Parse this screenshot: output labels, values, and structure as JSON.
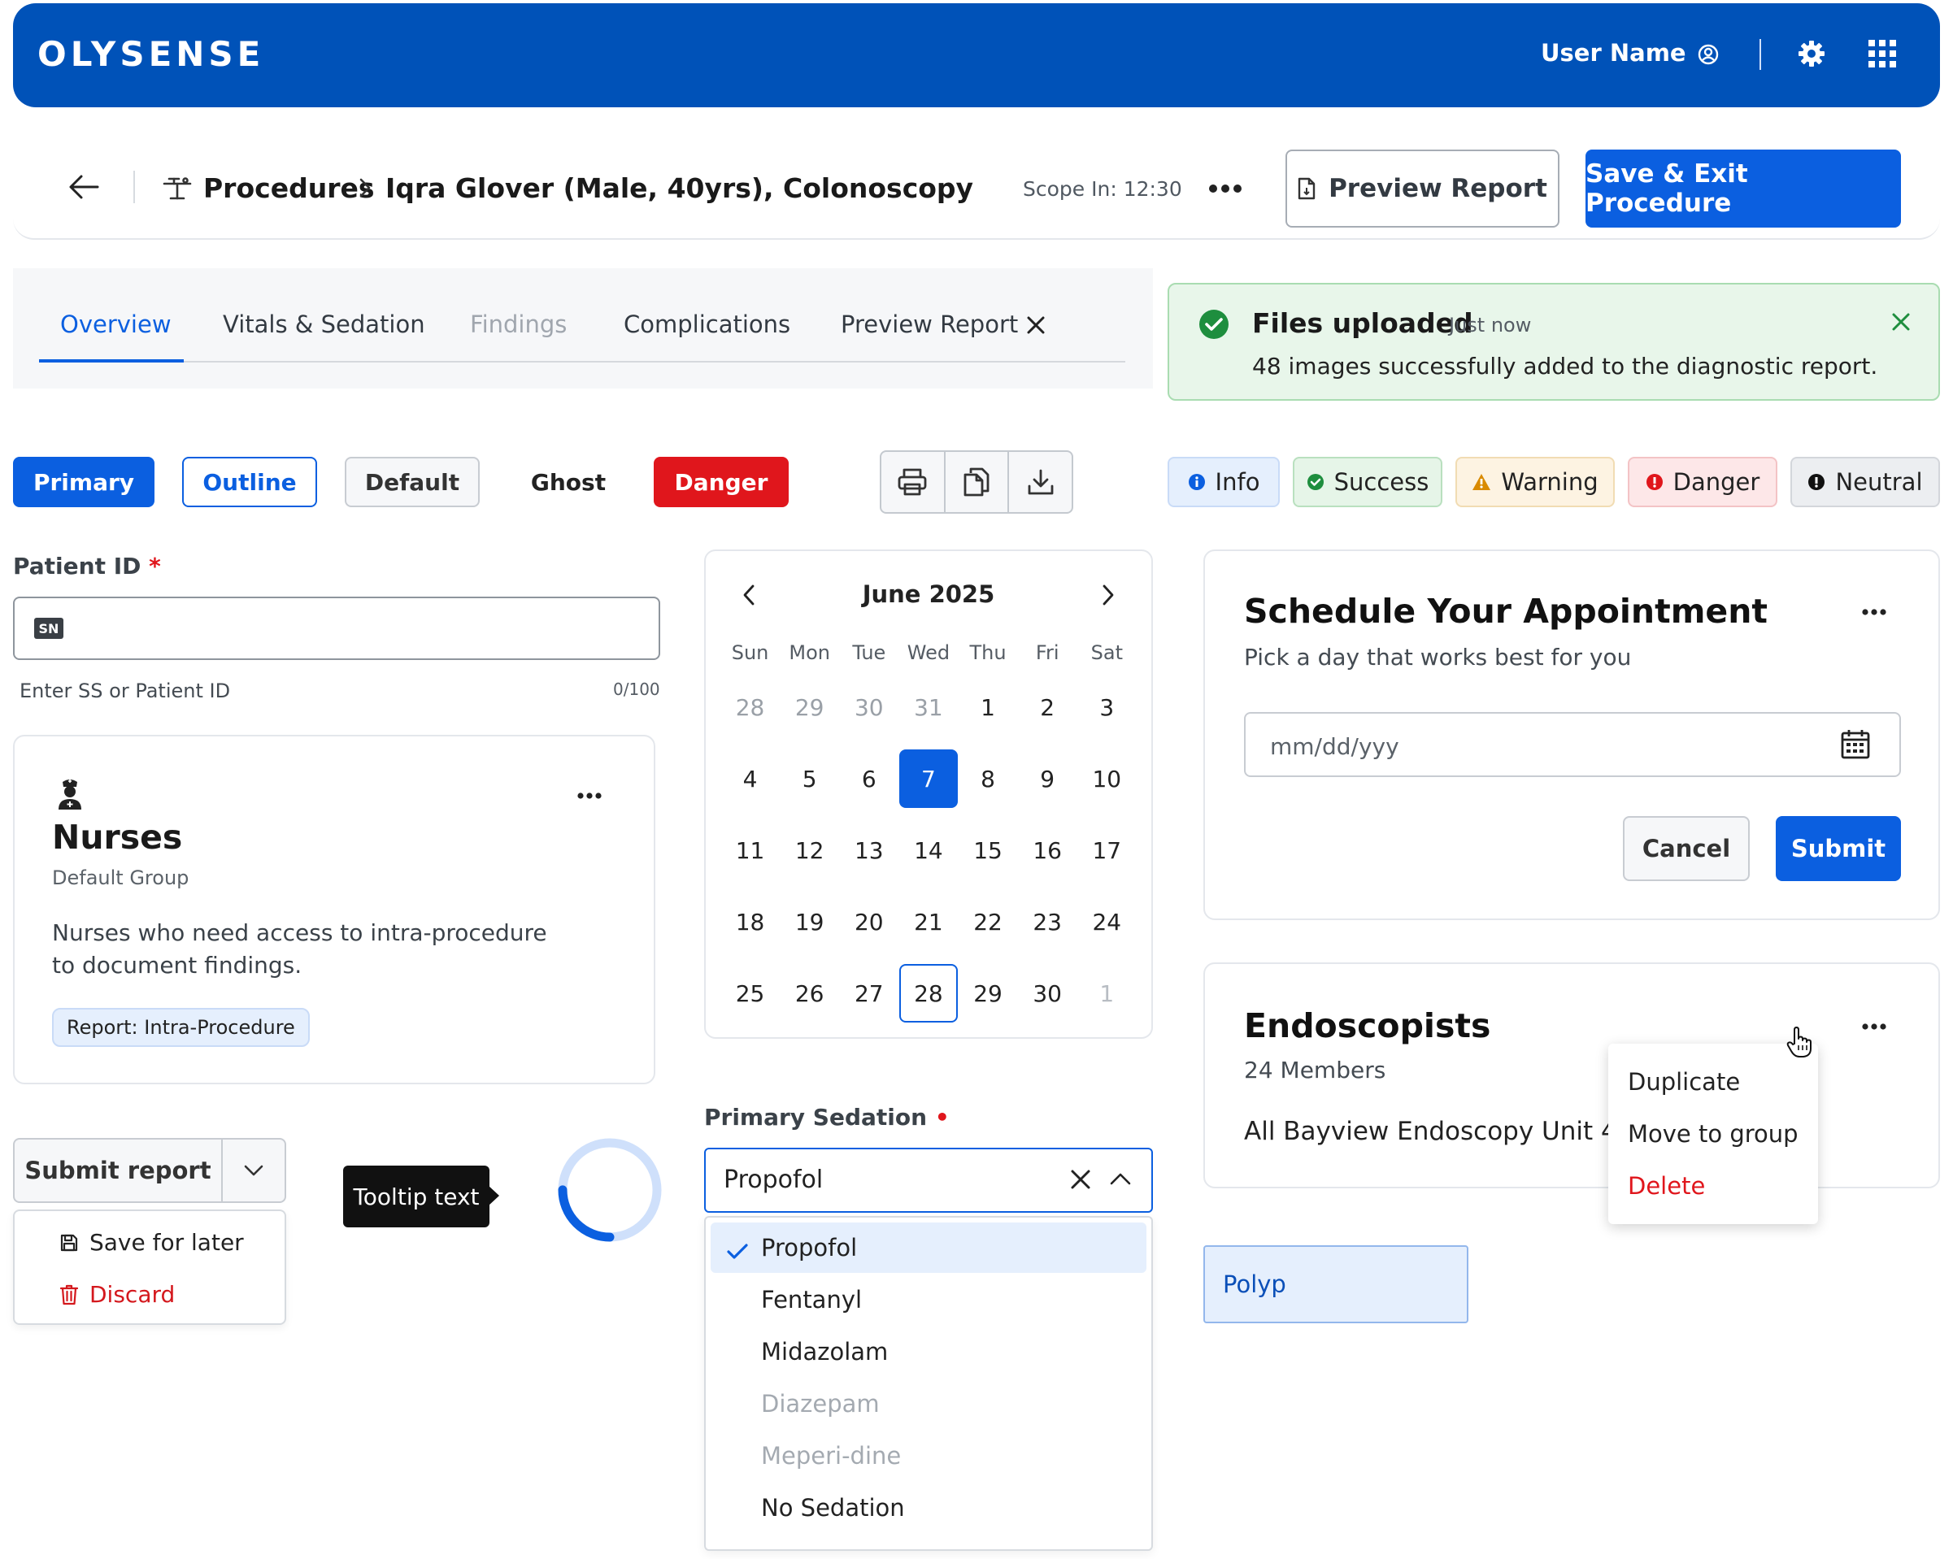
{
  "header": {
    "logo": "OLYSENSE",
    "user_name": "User Name"
  },
  "breadcrumb": {
    "section": "Procedures",
    "patient": "Iqra Glover (Male, 40yrs), Colonoscopy",
    "scope_in": "Scope In: 12:30",
    "preview_label": "Preview Report",
    "save_exit_label": "Save & Exit Procedure"
  },
  "tabs": [
    {
      "label": "Overview",
      "state": "active"
    },
    {
      "label": "Vitals & Sedation",
      "state": "normal"
    },
    {
      "label": "Findings",
      "state": "disabled"
    },
    {
      "label": "Complications",
      "state": "normal"
    },
    {
      "label": "Preview Report",
      "state": "closable"
    }
  ],
  "toast": {
    "title": "Files uploaded",
    "time": "Just now",
    "message": "48 images successfully added to the diagnostic report."
  },
  "buttons": {
    "primary": "Primary",
    "outline": "Outline",
    "default": "Default",
    "ghost": "Ghost",
    "danger": "Danger"
  },
  "badges": {
    "info": "Info",
    "success": "Success",
    "warning": "Warning",
    "danger": "Danger",
    "neutral": "Neutral"
  },
  "patient_id": {
    "label": "Patient ID",
    "required_mark": "*",
    "prefix_badge": "SN",
    "value": "",
    "helper": "Enter SS or Patient ID",
    "counter": "0/100"
  },
  "nurses_card": {
    "title": "Nurses",
    "subtitle": "Default Group",
    "description": "Nurses who need access to intra-procedure to document findings.",
    "tag": "Report: Intra-Procedure"
  },
  "split_button": {
    "label": "Submit report",
    "menu": {
      "save": "Save for later",
      "discard": "Discard"
    }
  },
  "tooltip": {
    "text": "Tooltip text"
  },
  "spinner": {
    "progress": 0.25
  },
  "calendar": {
    "title": "June 2025",
    "weekdays": [
      "Sun",
      "Mon",
      "Tue",
      "Wed",
      "Thu",
      "Fri",
      "Sat"
    ],
    "weeks": [
      [
        {
          "d": "28",
          "s": "muted"
        },
        {
          "d": "29",
          "s": "muted"
        },
        {
          "d": "30",
          "s": "muted"
        },
        {
          "d": "31",
          "s": "muted"
        },
        {
          "d": "1",
          "s": ""
        },
        {
          "d": "2",
          "s": ""
        },
        {
          "d": "3",
          "s": ""
        }
      ],
      [
        {
          "d": "4",
          "s": ""
        },
        {
          "d": "5",
          "s": ""
        },
        {
          "d": "6",
          "s": ""
        },
        {
          "d": "7",
          "s": "sel"
        },
        {
          "d": "8",
          "s": ""
        },
        {
          "d": "9",
          "s": ""
        },
        {
          "d": "10",
          "s": ""
        }
      ],
      [
        {
          "d": "11",
          "s": ""
        },
        {
          "d": "12",
          "s": ""
        },
        {
          "d": "13",
          "s": ""
        },
        {
          "d": "14",
          "s": ""
        },
        {
          "d": "15",
          "s": ""
        },
        {
          "d": "16",
          "s": ""
        },
        {
          "d": "17",
          "s": ""
        }
      ],
      [
        {
          "d": "18",
          "s": ""
        },
        {
          "d": "19",
          "s": ""
        },
        {
          "d": "20",
          "s": ""
        },
        {
          "d": "21",
          "s": ""
        },
        {
          "d": "22",
          "s": ""
        },
        {
          "d": "23",
          "s": ""
        },
        {
          "d": "24",
          "s": ""
        }
      ],
      [
        {
          "d": "25",
          "s": ""
        },
        {
          "d": "26",
          "s": ""
        },
        {
          "d": "27",
          "s": ""
        },
        {
          "d": "28",
          "s": "today"
        },
        {
          "d": "29",
          "s": ""
        },
        {
          "d": "30",
          "s": ""
        },
        {
          "d": "1",
          "s": "light"
        }
      ]
    ]
  },
  "sedation": {
    "label": "Primary Sedation",
    "required_mark": "•",
    "value": "Propofol",
    "options": [
      {
        "label": "Propofol",
        "state": "selected"
      },
      {
        "label": "Fentanyl",
        "state": "normal"
      },
      {
        "label": "Midazolam",
        "state": "normal"
      },
      {
        "label": "Diazepam",
        "state": "disabled"
      },
      {
        "label": "Meperi-dine",
        "state": "disabled"
      },
      {
        "label": "No Sedation",
        "state": "normal"
      }
    ]
  },
  "schedule_card": {
    "title": "Schedule Your Appointment",
    "subtitle": "Pick a day that works best for you",
    "date_placeholder": "mm/dd/yyy",
    "cancel": "Cancel",
    "submit": "Submit"
  },
  "endoscopists_card": {
    "title": "Endoscopists",
    "members": "24 Members",
    "description": "All Bayview Endoscopy Unit 4",
    "menu": {
      "duplicate": "Duplicate",
      "move": "Move to group",
      "delete": "Delete"
    }
  },
  "chip": {
    "label": "Polyp"
  },
  "colors": {
    "brand": "#0052b8",
    "accent": "#0b5fe0",
    "danger": "#e0161c",
    "success": "#1e8e3e",
    "warning": "#d98a00"
  }
}
